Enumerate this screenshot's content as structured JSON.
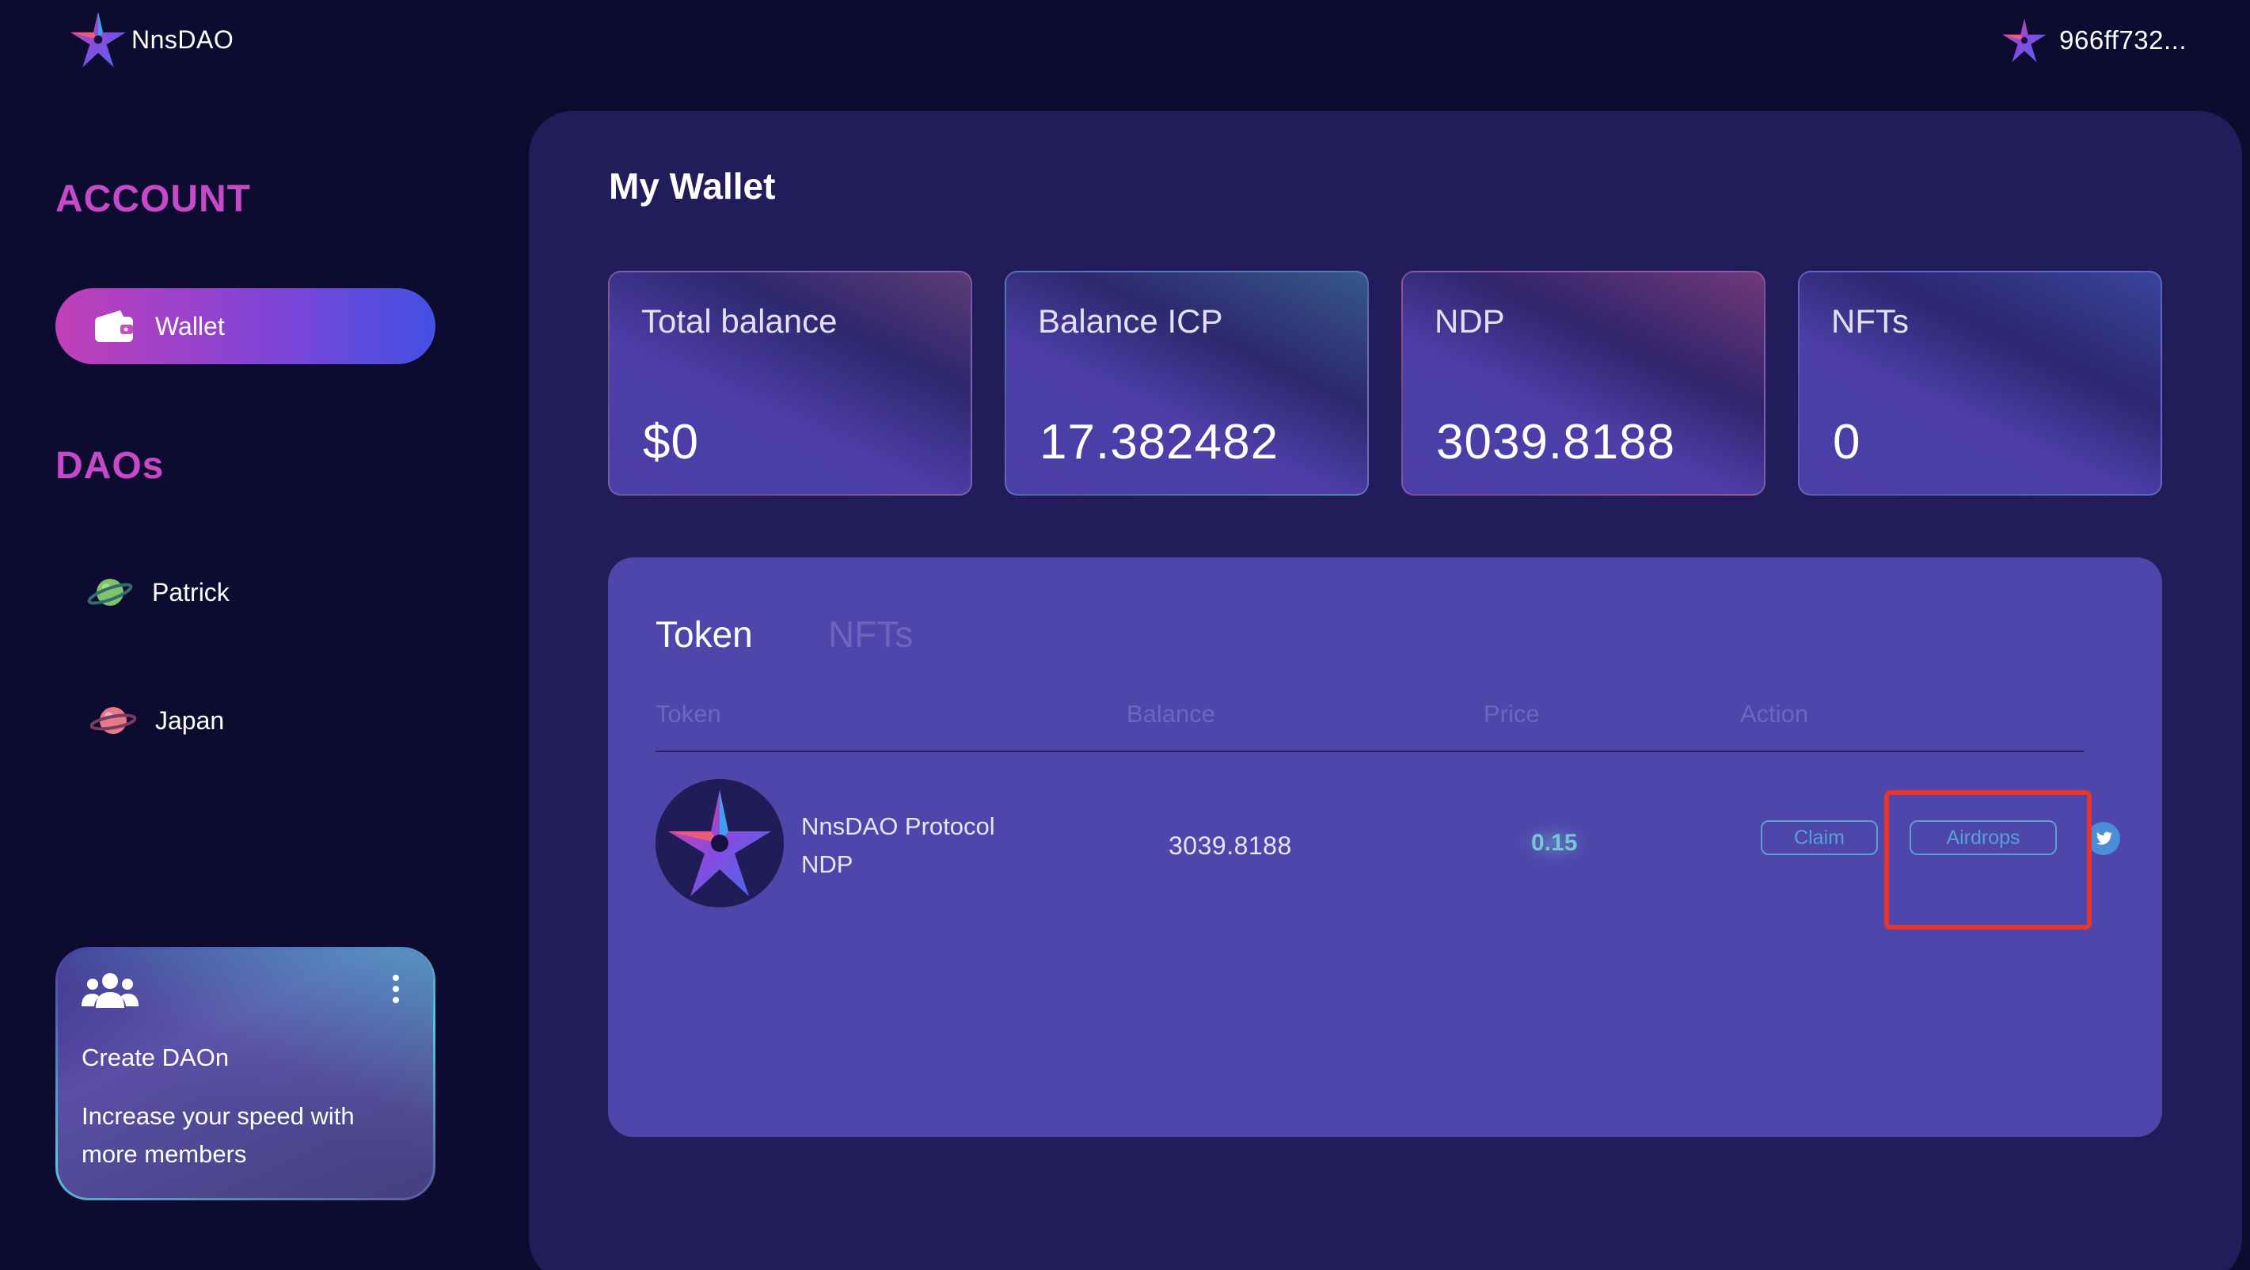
{
  "app": {
    "logo_text": "NnsDAO",
    "account_id": "966ff732..."
  },
  "sidebar": {
    "account_heading": "ACCOUNT",
    "wallet_label": "Wallet",
    "daos_heading": "DAOs",
    "daos": [
      {
        "label": "Patrick",
        "icon": "planet-green-icon"
      },
      {
        "label": "Japan",
        "icon": "planet-pink-icon"
      }
    ],
    "create_card": {
      "title": "Create DAOn",
      "description": "Increase your speed with more members",
      "icon": "team-icon"
    }
  },
  "main": {
    "title": "My Wallet",
    "stats": [
      {
        "label": "Total balance",
        "value": "$0"
      },
      {
        "label": "Balance ICP",
        "value": "17.382482"
      },
      {
        "label": "NDP",
        "value": "3039.8188"
      },
      {
        "label": "NFTs",
        "value": "0"
      }
    ],
    "tabs": [
      {
        "label": "Token",
        "active": true
      },
      {
        "label": "NFTs",
        "active": false
      }
    ],
    "table": {
      "headers": [
        "Token",
        "Balance",
        "Price",
        "Action"
      ],
      "rows": [
        {
          "name": "NnsDAO Protocol",
          "symbol": "NDP",
          "balance": "3039.8188",
          "price": "0.15",
          "actions": [
            "Claim",
            "Airdrops"
          ]
        }
      ]
    }
  },
  "colors": {
    "background": "#0d0b2f",
    "panel": "#221d5a",
    "token_panel": "#4e46aa",
    "accent_pink": "#c549c8",
    "action_blue": "#5a9fd6",
    "highlight_red": "#e5372e"
  }
}
